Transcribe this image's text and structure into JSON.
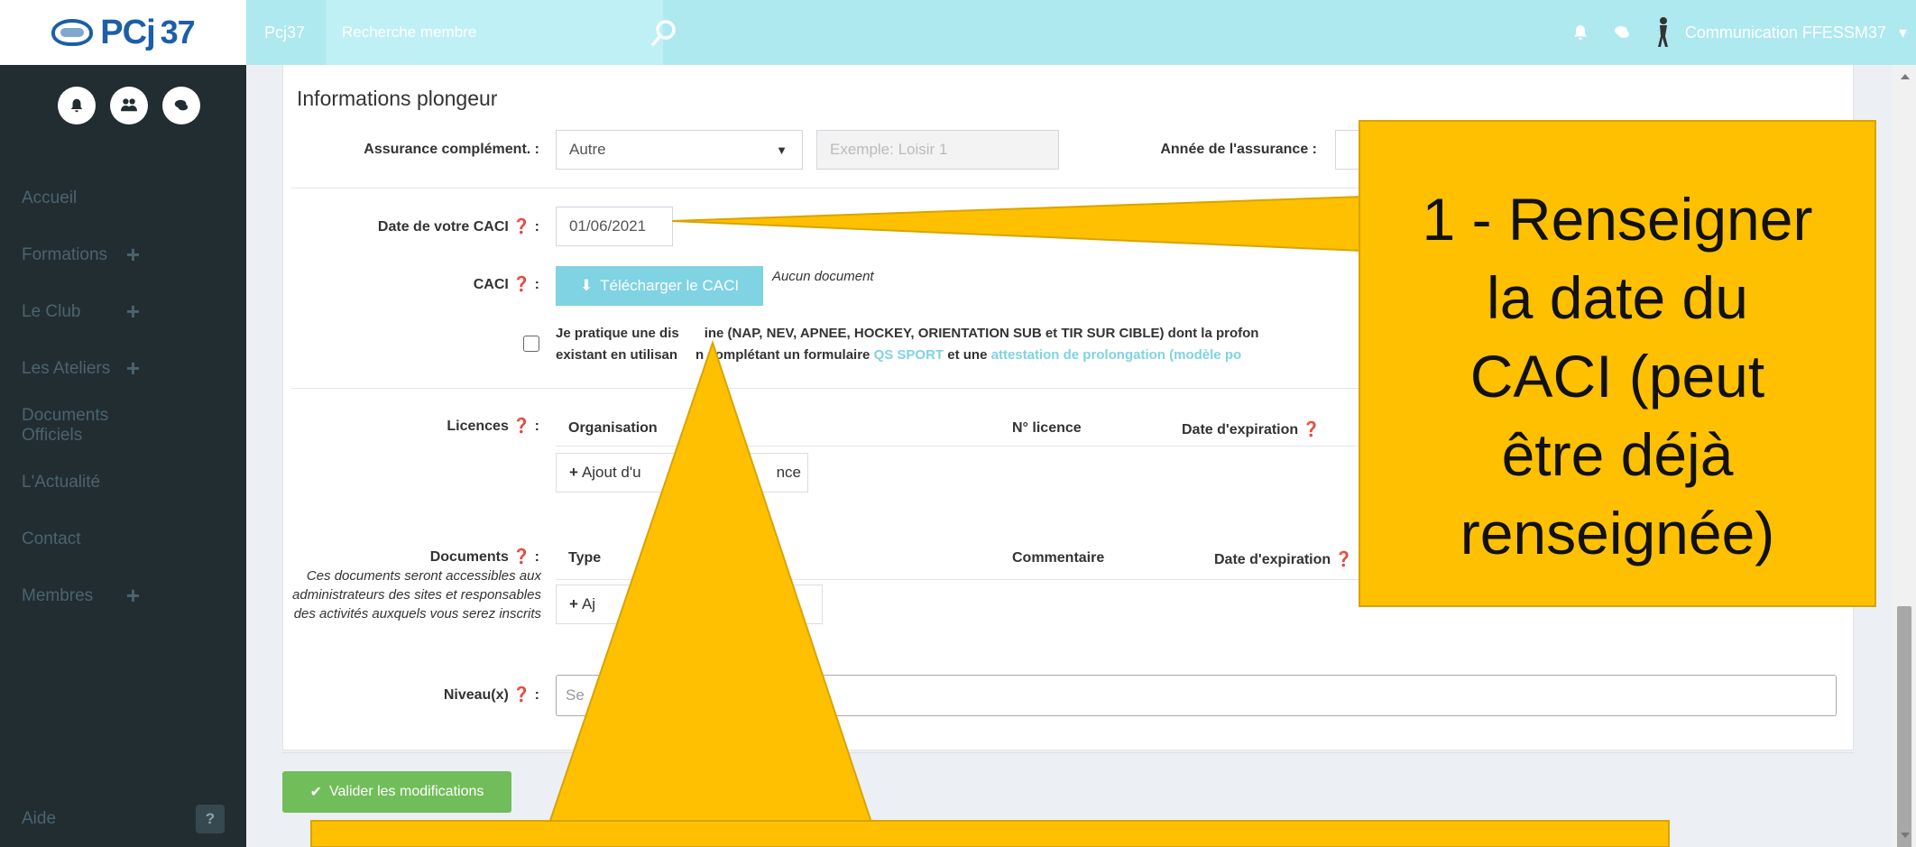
{
  "topbar": {
    "logo_text": "PCj",
    "logo_number": "37",
    "brand": "Pcj37",
    "search_placeholder": "Recherche membre",
    "user_name": "Communication FFESSM37",
    "icons": [
      "bell-icon",
      "comments-icon",
      "user-figure-icon"
    ],
    "bg_color": "#aee9f0"
  },
  "sidebar": {
    "items": [
      {
        "label": "Accueil",
        "expandable": false
      },
      {
        "label": "Formations",
        "expandable": true
      },
      {
        "label": "Le Club",
        "expandable": true
      },
      {
        "label": "Les Ateliers",
        "expandable": true
      },
      {
        "label": "Documents Officiels",
        "expandable": false
      },
      {
        "label": "L'Actualité",
        "expandable": false
      },
      {
        "label": "Contact",
        "expandable": false
      },
      {
        "label": "Membres",
        "expandable": true
      }
    ],
    "aide_label": "Aide",
    "aide_icon": "?",
    "bg_color": "#222d32"
  },
  "form": {
    "section_title": "Informations plongeur",
    "assurance_label": "Assurance complément. :",
    "assurance_value": "Autre",
    "assurance_example_placeholder": "Exemple: Loisir 1",
    "annee_label": "Année de l'assurance :",
    "caci_date_label": "Date de votre CACI",
    "caci_date_value": "01/06/2021",
    "caci_label": "CACI",
    "caci_button": "Télécharger le CACI",
    "caci_no_doc": "Aucun document",
    "discipline_text_line1": "Je pratique une dis",
    "discipline_text_line1b": "ine (NAP, NEV, APNEE, HOCKEY, ORIENTATION SUB et TIR SUR CIBLE) dont la profon",
    "discipline_text_line2a": "existant en utilisan",
    "discipline_text_line2b": "n complétant un formulaire",
    "link_qs_sport": "QS SPORT",
    "and_une": "et une",
    "link_attestation": "attestation de prolongation",
    "link_modele": "(modèle po",
    "licences_label": "Licences",
    "col_organisation": "Organisation",
    "col_num_licence": "N° licence",
    "col_date_exp": "Date d'expiration",
    "add_licence_a": "Ajout d'u",
    "add_licence_b": "nce",
    "documents_label": "Documents",
    "documents_note": "Ces documents seront accessibles aux administrateurs des sites et responsables des activités auxquels vous serez inscrits",
    "col_type": "Type",
    "col_commentaire": "Commentaire",
    "col_date_exp2": "Date d'expiration",
    "add_document_a": "Aj",
    "niveau_label": "Niveau(x)",
    "niveau_placeholder": "Se",
    "valider_button": "Valider les modifications"
  },
  "callout": {
    "lines": [
      "1 - Renseigner",
      "la date du",
      "CACI (peut",
      "être déjà",
      "renseignée)"
    ],
    "color": "#fec000"
  }
}
